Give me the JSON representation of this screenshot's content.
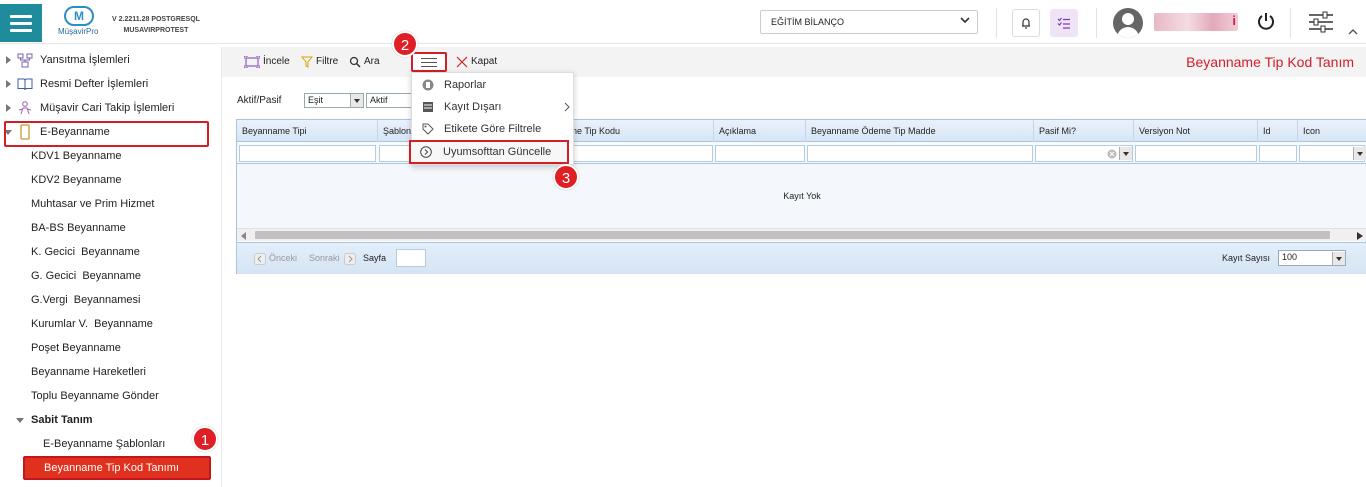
{
  "topbar": {
    "version": "V 2.2211.28 POSTGRESQL",
    "version_sub": "MUSAVIRPROTEST",
    "logo": "MüşavirPro",
    "company": "EĞİTİM BİLANÇO"
  },
  "sidebar": [
    {
      "label": "Yansıtma İşlemleri",
      "icon": "network-icon"
    },
    {
      "label": "Resmi Defter İşlemleri",
      "icon": "book-icon"
    },
    {
      "label": "Müşavir Cari Takip İşlemleri",
      "icon": "people-icon"
    },
    {
      "label": "E-Beyanname",
      "icon": "tablet-icon"
    },
    {
      "label": "KDV1 Beyanname"
    },
    {
      "label": "KDV2 Beyanname"
    },
    {
      "label": "Muhtasar ve Prim Hizmet"
    },
    {
      "label": "BA-BS Beyanname"
    },
    {
      "label": "K. Gecici  Beyanname"
    },
    {
      "label": "G. Gecici  Beyanname"
    },
    {
      "label": "G.Vergi  Beyannamesi"
    },
    {
      "label": "Kurumlar V.  Beyanname"
    },
    {
      "label": "Poşet Beyanname"
    },
    {
      "label": "Beyanname Hareketleri"
    },
    {
      "label": "Toplu Beyanname Gönder"
    },
    {
      "label": "Sabit Tanım"
    },
    {
      "label": "E-Beyanname Şablonları"
    },
    {
      "label": "Beyanname Tip Kod Tanımı"
    }
  ],
  "toolbar": {
    "incele": "İncele",
    "filtre": "Filtre",
    "ara": "Ara",
    "kapat": "Kapat",
    "title": "Beyanname Tip Kod Tanım"
  },
  "filter": {
    "label": "Aktif/Pasif",
    "op": "Eşit",
    "value": "Aktif"
  },
  "grid": {
    "columns": [
      "Beyanname Tipi",
      "Şablon",
      "ne Tip Kodu",
      "Açıklama",
      "Beyanname Ödeme Tip Madde",
      "Pasif Mi?",
      "Versiyon Not",
      "Id",
      "Icon"
    ],
    "empty": "Kayıt Yok"
  },
  "pager": {
    "prev": "Önceki",
    "next": "Sonraki",
    "page": "Sayfa",
    "count_label": "Kayıt Sayısı",
    "count": "100"
  },
  "menu": {
    "raporlar": "Raporlar",
    "kayit_disari": "Kayıt Dışarı",
    "etikete": "Etikete Göre Filtrele",
    "guncelle": "Uyumsofttan Güncelle"
  },
  "badges": [
    "1",
    "2",
    "3"
  ],
  "colors": {
    "accent": "#1f8c9b",
    "highlight": "#d21f26",
    "title": "#d01f2a"
  }
}
